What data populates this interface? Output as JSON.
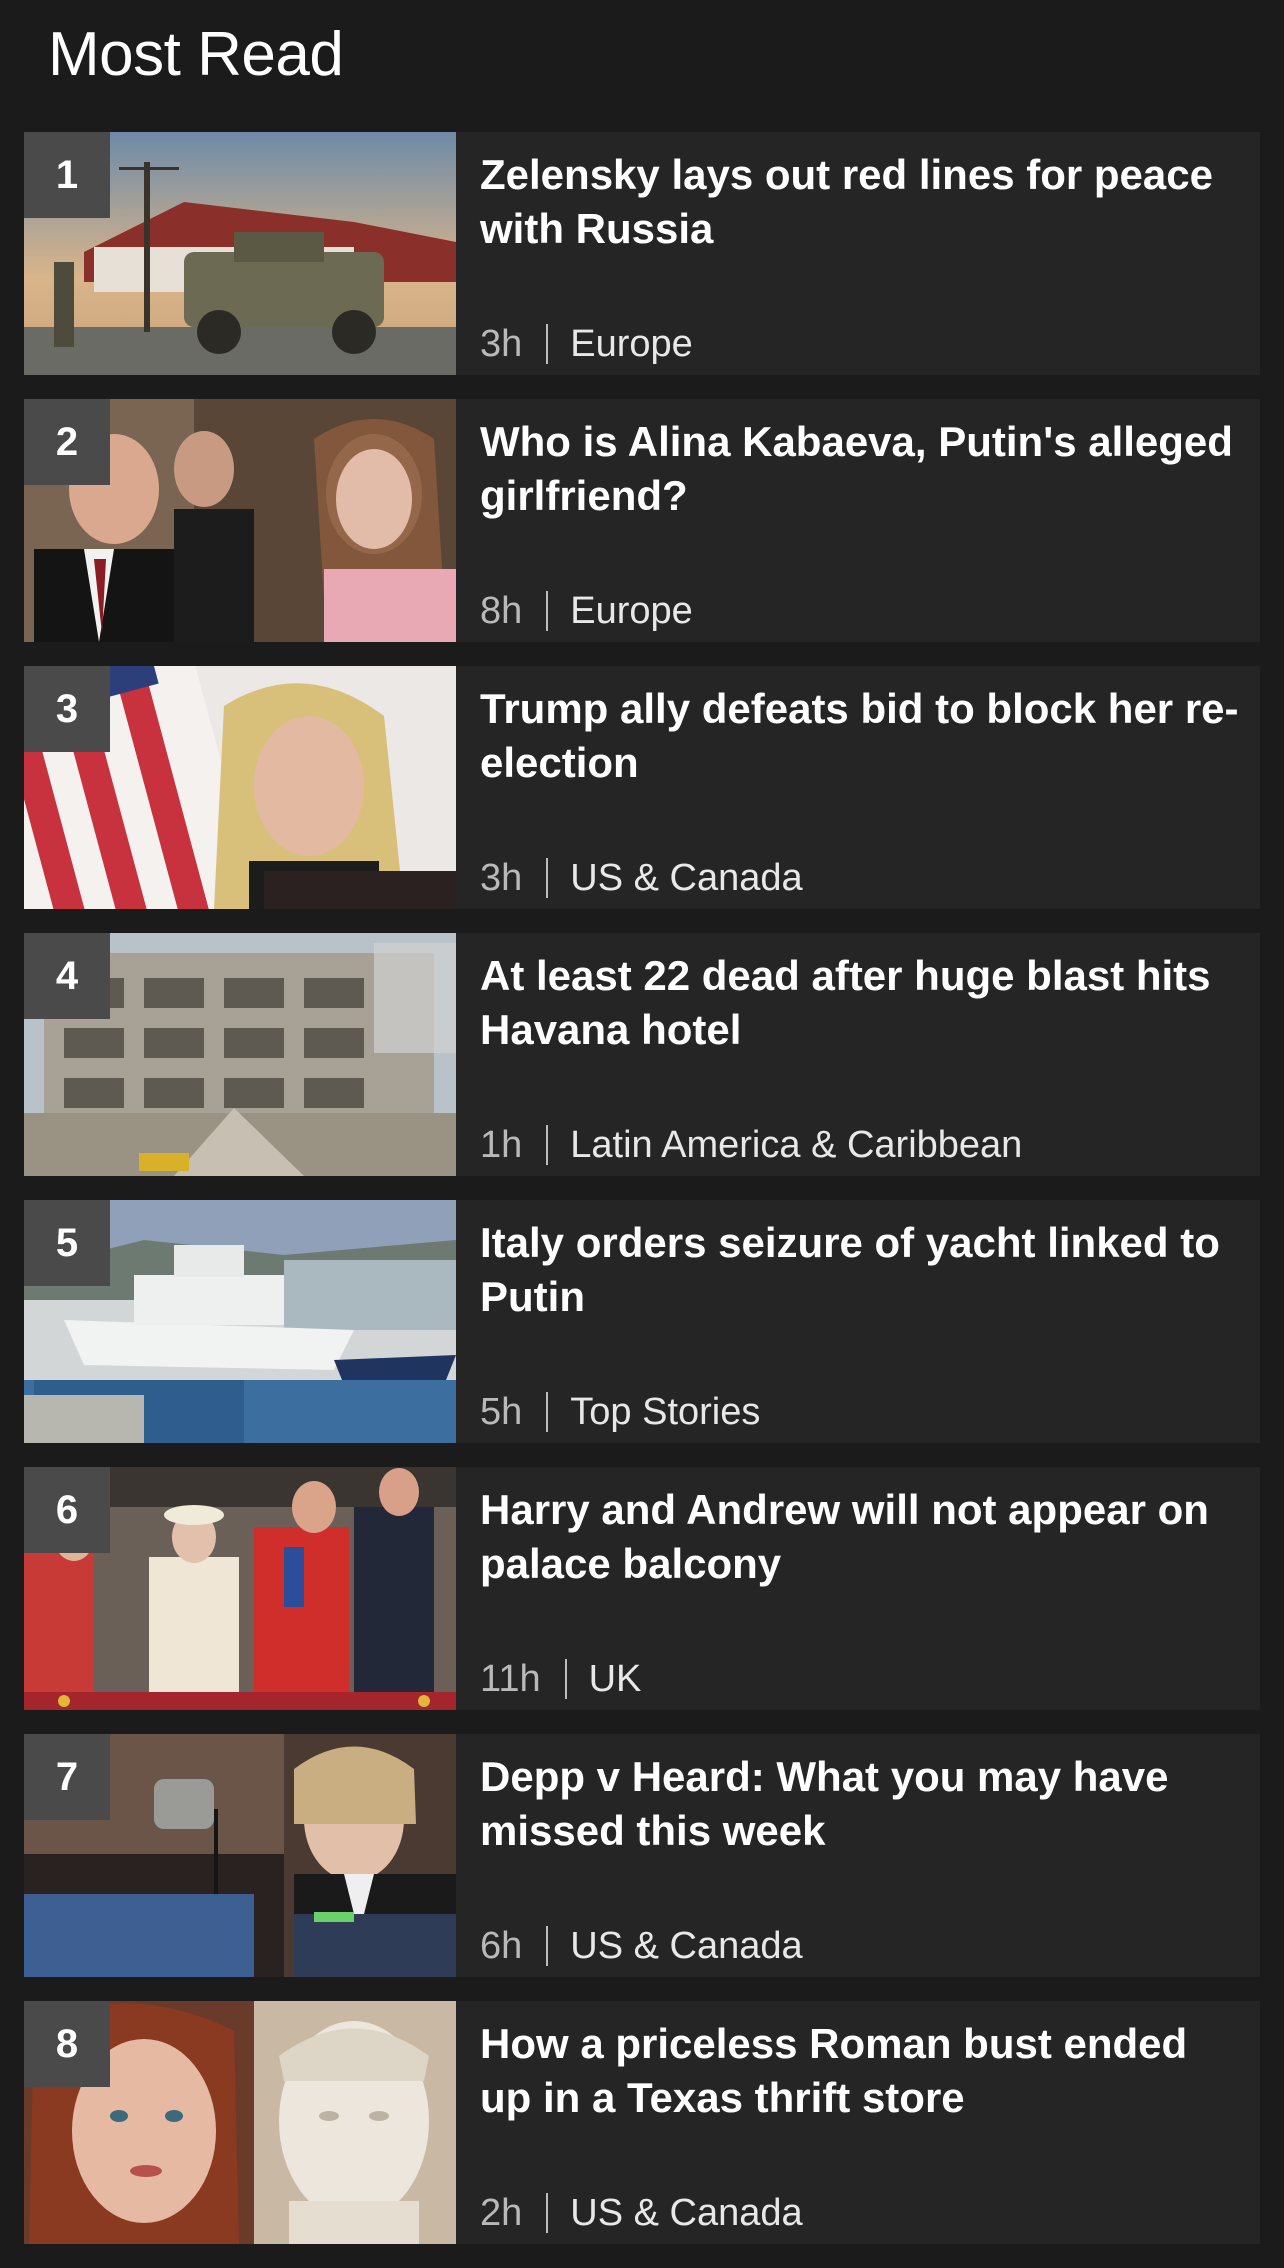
{
  "section": {
    "title": "Most Read"
  },
  "articles": [
    {
      "rank": "1",
      "headline": "Zelensky lays out red lines for peace with Russia",
      "time": "3h",
      "category": "Europe"
    },
    {
      "rank": "2",
      "headline": "Who is Alina Kabaeva, Putin's alleged girlfriend?",
      "time": "8h",
      "category": "Europe"
    },
    {
      "rank": "3",
      "headline": "Trump ally defeats bid to block her re-election",
      "time": "3h",
      "category": "US & Canada"
    },
    {
      "rank": "4",
      "headline": "At least 22 dead after huge blast hits Havana hotel",
      "time": "1h",
      "category": "Latin America & Caribbean"
    },
    {
      "rank": "5",
      "headline": "Italy orders seizure of yacht linked to Putin",
      "time": "5h",
      "category": "Top Stories"
    },
    {
      "rank": "6",
      "headline": "Harry and Andrew will not appear on palace balcony",
      "time": "11h",
      "category": "UK"
    },
    {
      "rank": "7",
      "headline": "Depp v Heard: What you may have missed this week",
      "time": "6h",
      "category": "US & Canada"
    },
    {
      "rank": "8",
      "headline": "How a priceless Roman bust ended up in a Texas thrift store",
      "time": "2h",
      "category": "US & Canada"
    }
  ]
}
